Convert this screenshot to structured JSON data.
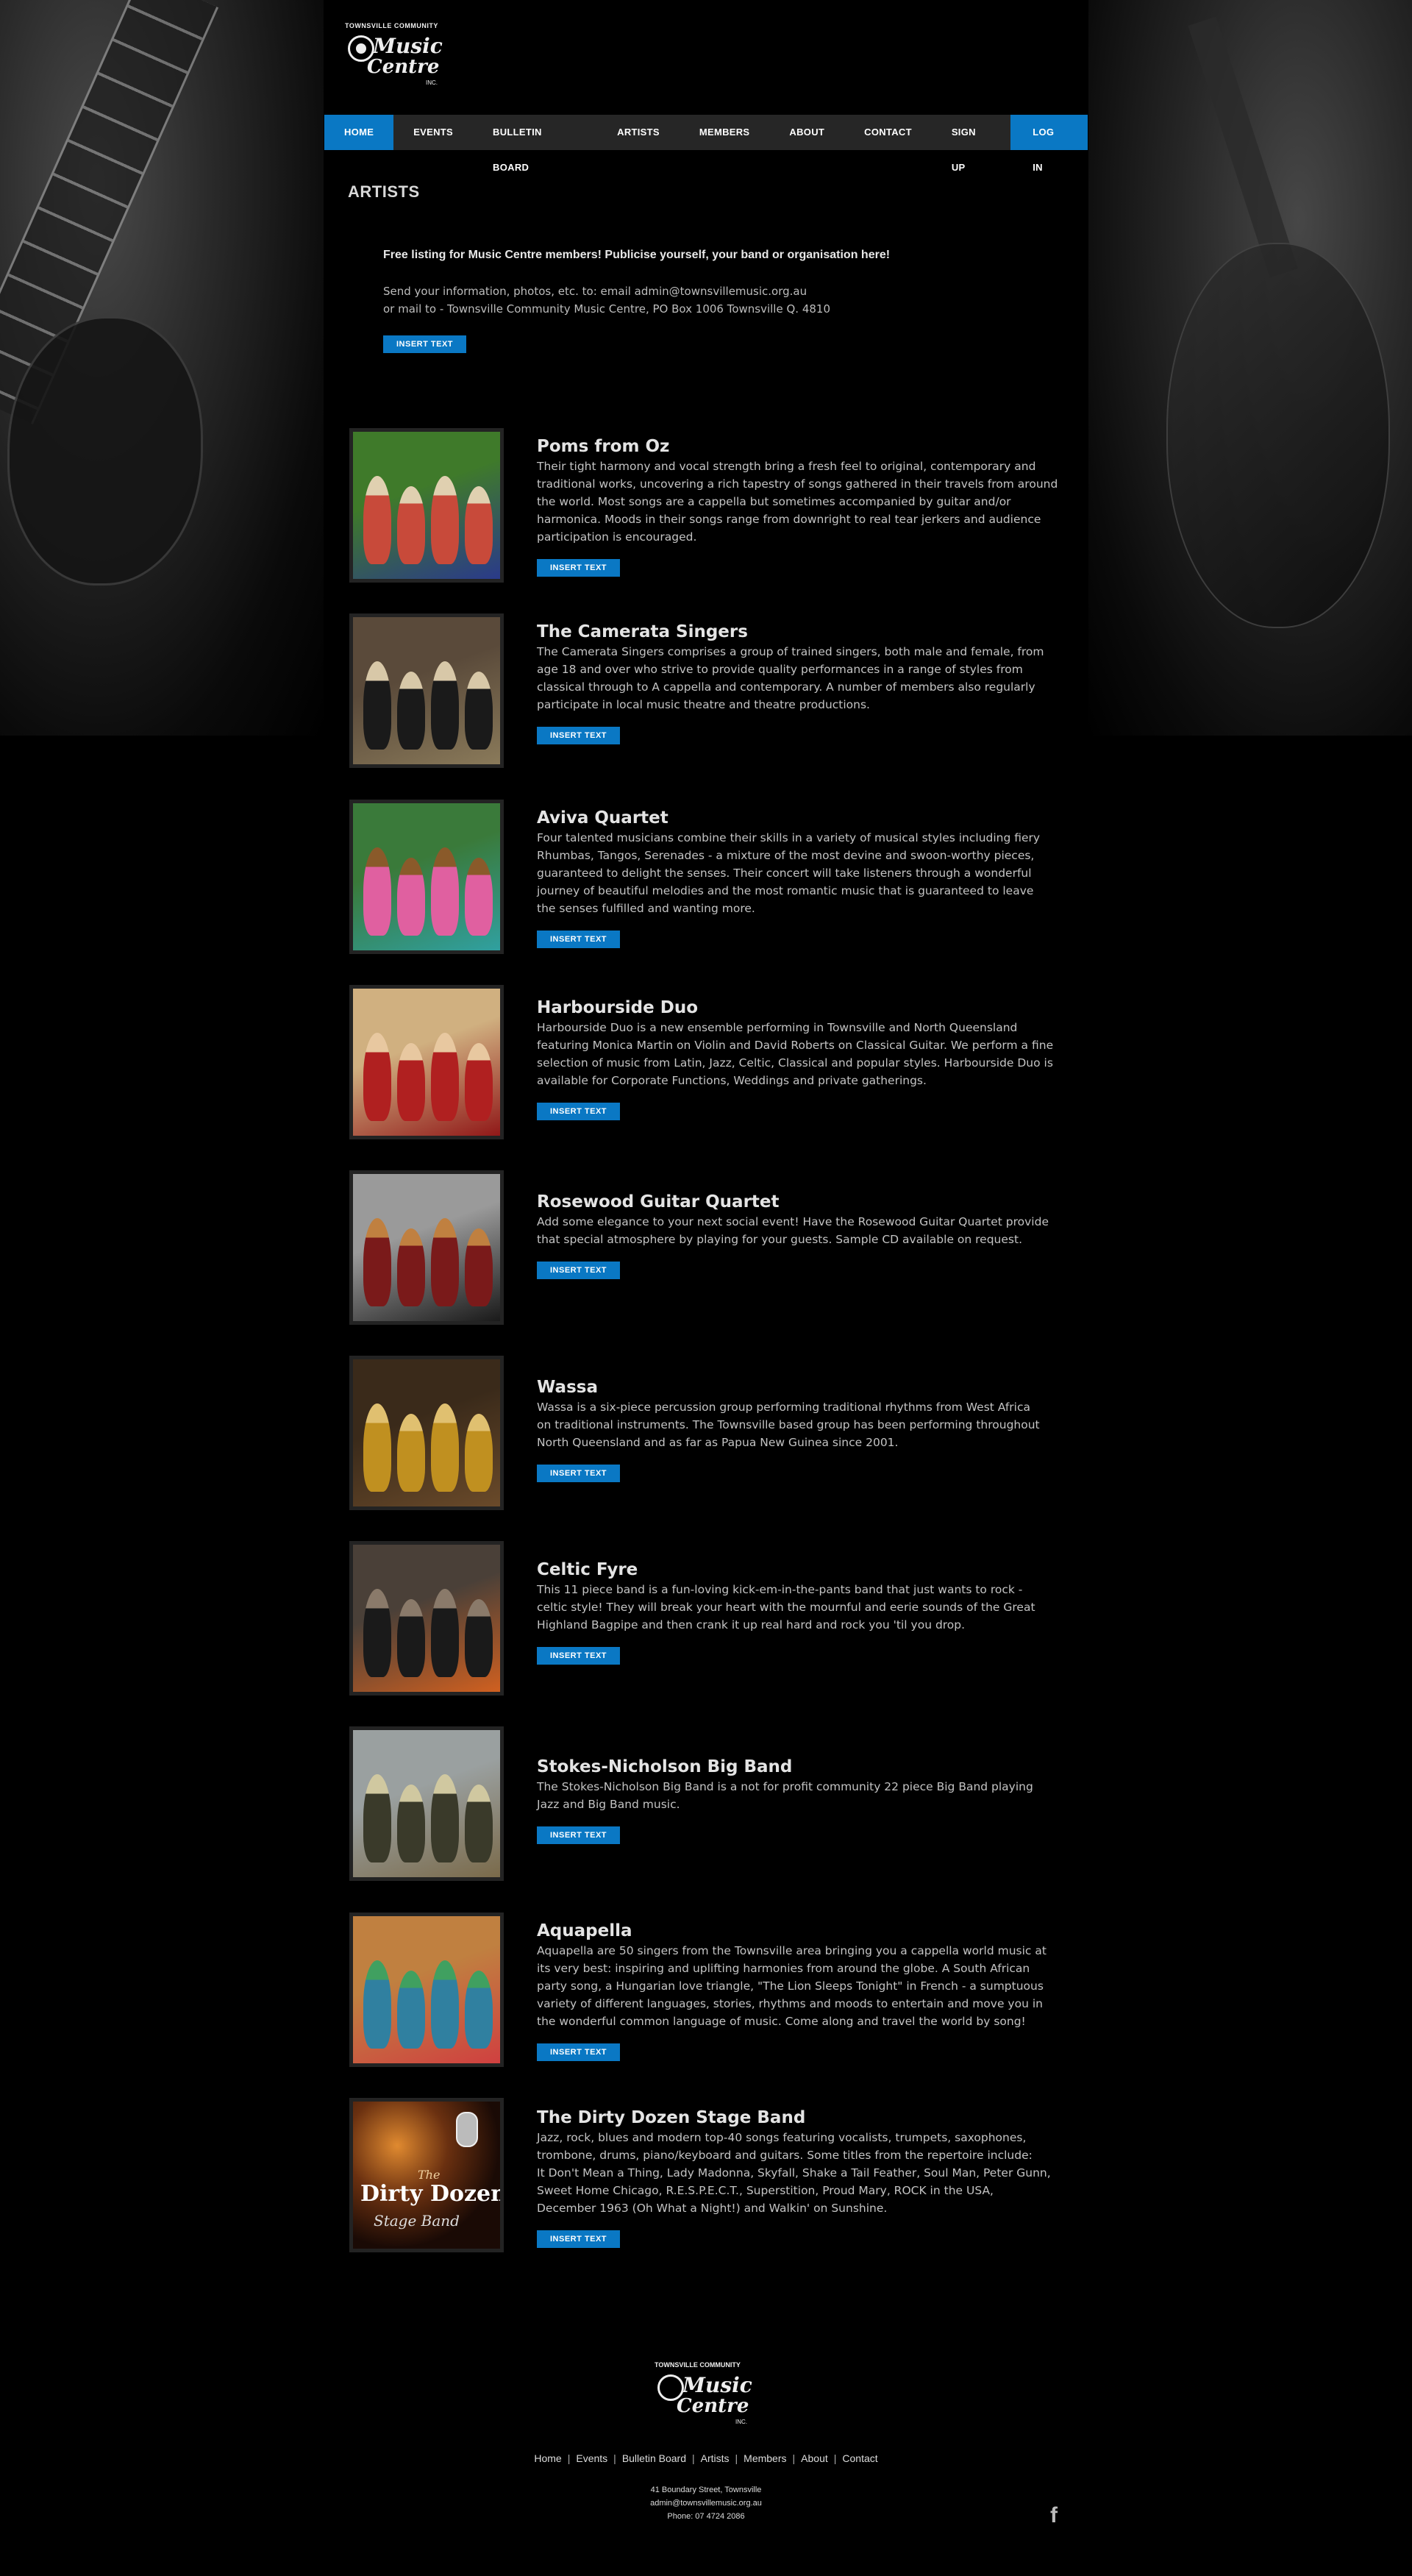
{
  "brand": {
    "top_line": "TOWNSVILLE COMMUNITY",
    "word1": "Music",
    "word2": "Centre",
    "suffix": "INC."
  },
  "nav": {
    "items": [
      "HOME",
      "EVENTS",
      "BULLETIN BOARD",
      "ARTISTS",
      "MEMBERS",
      "ABOUT",
      "CONTACT"
    ],
    "signup": "SIGN UP",
    "login": "LOG IN",
    "active": "HOME"
  },
  "page_title": "ARTISTS",
  "intro": {
    "headline": "Free listing for Music Centre members! Publicise yourself, your band or organisation here!",
    "line1": "Send your information, photos, etc. to: email admin@townsvillemusic.org.au",
    "line2": "or mail to - Townsville Community Music Centre, PO Box 1006 Townsville Q. 4810",
    "button": "INSERT TEXT"
  },
  "artists": [
    {
      "name": "Poms from Oz",
      "description": "Their tight harmony and vocal strength bring a fresh feel to original, contemporary and\ntraditional works, uncovering a rich tapestry of songs gathered in their travels from around\nthe world. Most songs are a cappella but sometimes accompanied by guitar and/or\nharmonica. Moods in their songs range from downright to real tear jerkers and audience\nparticipation is encouraged.",
      "button": "INSERT TEXT",
      "photo_colors": [
        "#3f7a2a",
        "#c84a3a",
        "#2a3a8a",
        "#e0d0b0"
      ]
    },
    {
      "name": "The Camerata Singers",
      "description": "The Camerata Singers comprises a group of trained singers, both male and female, from\nage 18 and over who strive to provide quality performances in a range of styles from\nclassical through to A cappella and contemporary. A number of members also regularly\nparticipate in local music theatre and theatre productions.",
      "button": "INSERT TEXT",
      "photo_colors": [
        "#5a4a3a",
        "#1a1a1a",
        "#8a7a5a",
        "#d8c8a8"
      ]
    },
    {
      "name": "Aviva Quartet",
      "description": "Four talented musicians combine their skills in a variety of musical styles including fiery\nRhumbas, Tangos, Serenades - a mixture of the most devine and swoon-worthy pieces,\nguaranteed to delight the senses. Their concert will take listeners through a wonderful\njourney of beautiful melodies and the most romantic music that is guaranteed to leave\nthe senses fulfilled and wanting more.",
      "button": "INSERT TEXT",
      "photo_colors": [
        "#3a7a3a",
        "#e060a0",
        "#30a0a0",
        "#8a5a2a"
      ]
    },
    {
      "name": "Harbourside Duo",
      "description": "Harbourside Duo is a new ensemble performing in Townsville and North Queensland\nfeaturing Monica Martin on Violin and David Roberts on Classical Guitar.  We perform a fine\nselection of music from Latin, Jazz, Celtic, Classical and popular styles. Harbourside Duo is\navailable for Corporate Functions, Weddings and private gatherings.",
      "button": "INSERT TEXT",
      "photo_colors": [
        "#d0b080",
        "#b02020",
        "#901818",
        "#e8c8a0"
      ]
    },
    {
      "name": "Rosewood Guitar Quartet",
      "description": "Add some elegance to your next social event! Have the Rosewood Guitar Quartet provide\nthat special atmosphere by playing for your guests. Sample CD available on request.",
      "button": "INSERT TEXT",
      "photo_colors": [
        "#9a9a9a",
        "#7a1a1a",
        "#1a1a1a",
        "#c08040"
      ]
    },
    {
      "name": "Wassa",
      "description": "Wassa is a six-piece percussion group performing traditional rhythms from West Africa\non traditional instruments. The Townsville based group has been performing throughout\nNorth Queensland and as far as Papua New Guinea since 2001.",
      "button": "INSERT TEXT",
      "photo_colors": [
        "#3a2a1a",
        "#c09020",
        "#6a4a2a",
        "#e0c070"
      ]
    },
    {
      "name": "Celtic Fyre",
      "description": "This 11 piece band is a fun-loving kick-em-in-the-pants band that just wants to rock -\nceltic style! They will break your heart with the mournful and eerie sounds of the Great\nHighland  Bagpipe and then crank it up real hard and rock you 'til you drop.",
      "button": "INSERT TEXT",
      "photo_colors": [
        "#4a4038",
        "#1a1a1a",
        "#d06020",
        "#8a7a6a"
      ]
    },
    {
      "name": "Stokes-Nicholson Big Band",
      "description": "The Stokes-Nicholson Big Band is a not for profit community 22 piece Big Band playing\nJazz and Big Band music.",
      "button": "INSERT TEXT",
      "photo_colors": [
        "#9aa0a0",
        "#3a3a2a",
        "#7a6a4a",
        "#d0c8a0"
      ]
    },
    {
      "name": "Aquapella",
      "description": "Aquapella are 50 singers from the Townsville area bringing you a cappella world music at\nits very best: inspiring and uplifting harmonies from around the globe. A South African\nparty song, a Hungarian love triangle, \"The Lion Sleeps Tonight\" in French - a sumptuous\nvariety of different languages, stories, rhythms and moods to entertain and move you in\nthe wonderful common language of music. Come along and travel the world by song!",
      "button": "INSERT TEXT",
      "photo_colors": [
        "#c08040",
        "#3080a0",
        "#d04040",
        "#40a060"
      ]
    },
    {
      "name": "The Dirty Dozen Stage Band",
      "description": "Jazz, rock, blues and modern top-40 songs featuring vocalists, trumpets, saxophones,\ntrombone, drums, piano/keyboard and guitars. Some titles from the repertoire include:\nIt Don't Mean a Thing, Lady Madonna, Skyfall, Shake a Tail Feather, Soul Man, Peter Gunn,\nSweet Home Chicago, R.E.S.P.E.C.T., Superstition, Proud Mary, ROCK in the USA,\nDecember 1963 (Oh What a Night!) and Walkin' on Sunshine.",
      "button": "INSERT TEXT",
      "photo_colors": [
        "#2a1a10",
        "#e08a30",
        "#f0d0a0",
        "#ffffff"
      ],
      "photo_text": {
        "small": "The",
        "big": "Dirty Dozen",
        "script": "Stage Band"
      }
    }
  ],
  "footer": {
    "links": [
      "Home",
      "Events",
      "Bulletin Board",
      "Artists",
      "Members",
      "About",
      "Contact"
    ],
    "address": "41 Boundary Street, Townsville",
    "email": "admin@townsvillemusic.org.au",
    "phone": "Phone: 07 4724 2086",
    "social_icon": "facebook-icon",
    "social_glyph": "f"
  },
  "colors": {
    "accent": "#0a78c4",
    "background": "#000000",
    "nav_bg": "#262626"
  }
}
